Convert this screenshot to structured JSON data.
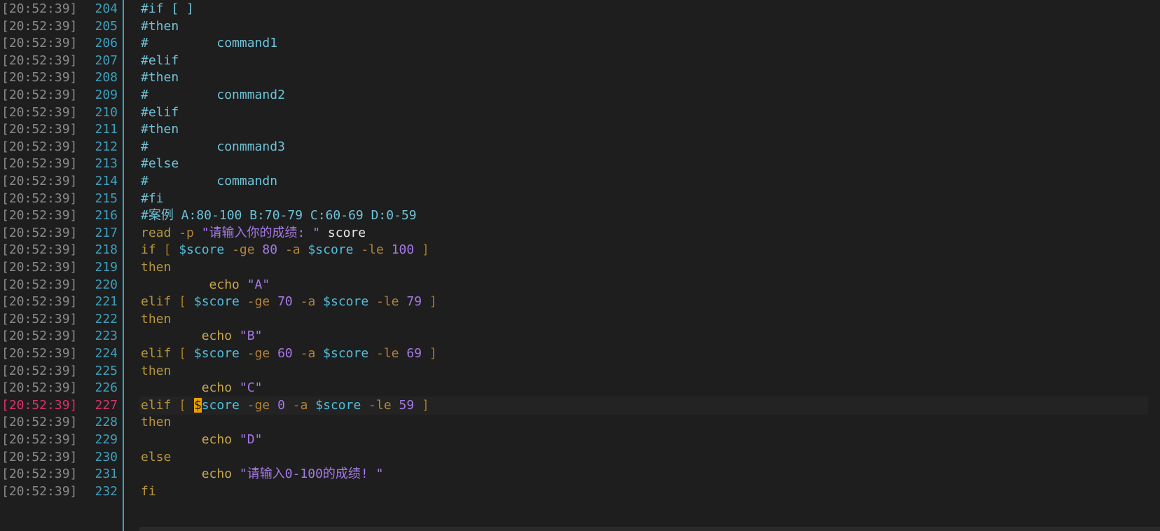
{
  "editor": {
    "timestamp": "[20:52:39]",
    "current_line": 227,
    "lines": [
      {
        "n": "204",
        "tokens": [
          {
            "c": "t-comment",
            "t": "#if [ ]"
          }
        ]
      },
      {
        "n": "205",
        "tokens": [
          {
            "c": "t-comment",
            "t": "#then"
          }
        ]
      },
      {
        "n": "206",
        "tokens": [
          {
            "c": "t-comment",
            "t": "#         command1"
          }
        ]
      },
      {
        "n": "207",
        "tokens": [
          {
            "c": "t-comment",
            "t": "#elif"
          }
        ]
      },
      {
        "n": "208",
        "tokens": [
          {
            "c": "t-comment",
            "t": "#then"
          }
        ]
      },
      {
        "n": "209",
        "tokens": [
          {
            "c": "t-comment",
            "t": "#         conmmand2"
          }
        ]
      },
      {
        "n": "210",
        "tokens": [
          {
            "c": "t-comment",
            "t": "#elif"
          }
        ]
      },
      {
        "n": "211",
        "tokens": [
          {
            "c": "t-comment",
            "t": "#then"
          }
        ]
      },
      {
        "n": "212",
        "tokens": [
          {
            "c": "t-comment",
            "t": "#         conmmand3"
          }
        ]
      },
      {
        "n": "213",
        "tokens": [
          {
            "c": "t-comment",
            "t": "#else"
          }
        ]
      },
      {
        "n": "214",
        "tokens": [
          {
            "c": "t-comment",
            "t": "#         commandn"
          }
        ]
      },
      {
        "n": "215",
        "tokens": [
          {
            "c": "t-comment",
            "t": "#fi"
          }
        ]
      },
      {
        "n": "216",
        "tokens": [
          {
            "c": "t-comment",
            "t": "#案例 A:80-100 B:70-79 C:60-69 D:0-59"
          }
        ]
      },
      {
        "n": "217",
        "tokens": [
          {
            "c": "t-kw",
            "t": "read "
          },
          {
            "c": "t-op",
            "t": "-p "
          },
          {
            "c": "t-str",
            "t": "\"请输入你的成绩: \""
          },
          {
            "c": "t-plain",
            "t": " score"
          }
        ]
      },
      {
        "n": "218",
        "tokens": [
          {
            "c": "t-kw",
            "t": "if "
          },
          {
            "c": "t-brk",
            "t": "[ "
          },
          {
            "c": "t-var",
            "t": "$score"
          },
          {
            "c": "t-op",
            "t": " -ge "
          },
          {
            "c": "t-num",
            "t": "80"
          },
          {
            "c": "t-op",
            "t": " -a "
          },
          {
            "c": "t-var",
            "t": "$score"
          },
          {
            "c": "t-op",
            "t": " -le "
          },
          {
            "c": "t-num",
            "t": "100"
          },
          {
            "c": "t-brk",
            "t": " ]"
          }
        ]
      },
      {
        "n": "219",
        "tokens": [
          {
            "c": "t-kw",
            "t": "then"
          }
        ]
      },
      {
        "n": "220",
        "tokens": [
          {
            "c": "t-cmd",
            "t": "         echo "
          },
          {
            "c": "t-str",
            "t": "\"A\""
          }
        ]
      },
      {
        "n": "221",
        "tokens": [
          {
            "c": "t-kw",
            "t": "elif "
          },
          {
            "c": "t-brk",
            "t": "[ "
          },
          {
            "c": "t-var",
            "t": "$score"
          },
          {
            "c": "t-op",
            "t": " -ge "
          },
          {
            "c": "t-num",
            "t": "70"
          },
          {
            "c": "t-op",
            "t": " -a "
          },
          {
            "c": "t-var",
            "t": "$score"
          },
          {
            "c": "t-op",
            "t": " -le "
          },
          {
            "c": "t-num",
            "t": "79"
          },
          {
            "c": "t-brk",
            "t": " ]"
          }
        ]
      },
      {
        "n": "222",
        "tokens": [
          {
            "c": "t-kw",
            "t": "then"
          }
        ]
      },
      {
        "n": "223",
        "tokens": [
          {
            "c": "t-cmd",
            "t": "        echo "
          },
          {
            "c": "t-str",
            "t": "\"B\""
          }
        ]
      },
      {
        "n": "224",
        "tokens": [
          {
            "c": "t-kw",
            "t": "elif "
          },
          {
            "c": "t-brk",
            "t": "[ "
          },
          {
            "c": "t-var",
            "t": "$score"
          },
          {
            "c": "t-op",
            "t": " -ge "
          },
          {
            "c": "t-num",
            "t": "60"
          },
          {
            "c": "t-op",
            "t": " -a "
          },
          {
            "c": "t-var",
            "t": "$score"
          },
          {
            "c": "t-op",
            "t": " -le "
          },
          {
            "c": "t-num",
            "t": "69"
          },
          {
            "c": "t-brk",
            "t": " ]"
          }
        ]
      },
      {
        "n": "225",
        "tokens": [
          {
            "c": "t-kw",
            "t": "then"
          }
        ]
      },
      {
        "n": "226",
        "tokens": [
          {
            "c": "t-cmd",
            "t": "        echo "
          },
          {
            "c": "t-str",
            "t": "\"C\""
          }
        ]
      },
      {
        "n": "227",
        "tokens": [
          {
            "c": "t-kw",
            "t": "elif "
          },
          {
            "c": "t-brk",
            "t": "[ "
          },
          {
            "c": "cursor",
            "t": "$"
          },
          {
            "c": "t-var",
            "t": "score"
          },
          {
            "c": "t-op",
            "t": " -ge "
          },
          {
            "c": "t-num",
            "t": "0"
          },
          {
            "c": "t-op",
            "t": " -a "
          },
          {
            "c": "t-var",
            "t": "$score"
          },
          {
            "c": "t-op",
            "t": " -le "
          },
          {
            "c": "t-num",
            "t": "59"
          },
          {
            "c": "t-brk",
            "t": " ]"
          }
        ]
      },
      {
        "n": "228",
        "tokens": [
          {
            "c": "t-kw",
            "t": "then"
          }
        ]
      },
      {
        "n": "229",
        "tokens": [
          {
            "c": "t-cmd",
            "t": "        echo "
          },
          {
            "c": "t-str",
            "t": "\"D\""
          }
        ]
      },
      {
        "n": "230",
        "tokens": [
          {
            "c": "t-kw",
            "t": "else"
          }
        ]
      },
      {
        "n": "231",
        "tokens": [
          {
            "c": "t-cmd",
            "t": "        echo "
          },
          {
            "c": "t-str",
            "t": "\"请输入0-100的成绩! \""
          }
        ]
      },
      {
        "n": "232",
        "tokens": [
          {
            "c": "t-kw",
            "t": "fi"
          }
        ]
      }
    ]
  }
}
